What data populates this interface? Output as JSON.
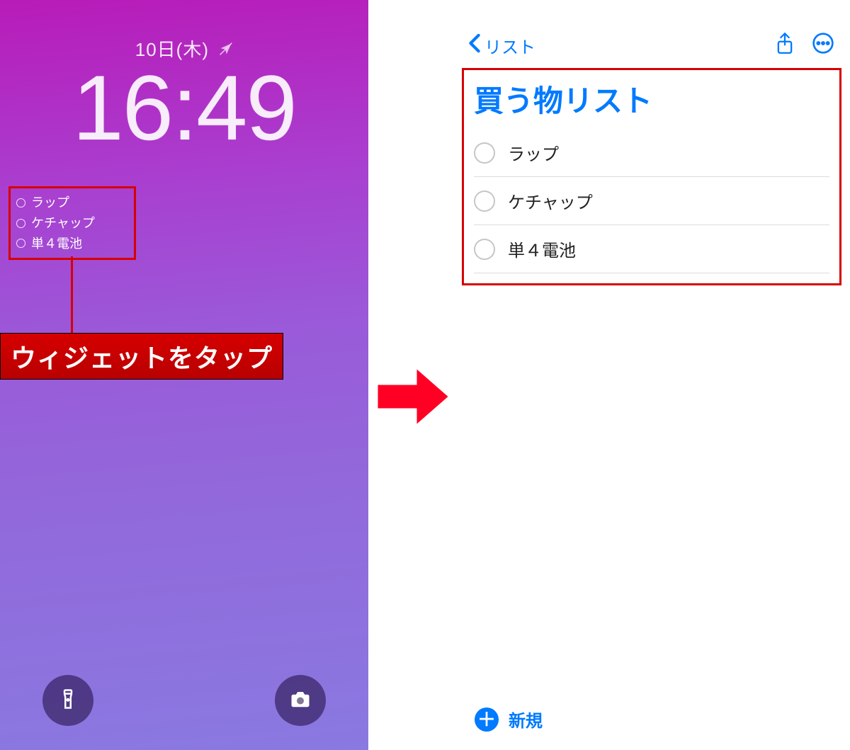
{
  "lockscreen": {
    "date": "10日(木)",
    "time": "16:49",
    "widget": {
      "items": [
        "ラップ",
        "ケチャップ",
        "単４電池"
      ]
    },
    "annotation": "ウィジェットをタップ"
  },
  "reminders": {
    "back_label": "リスト",
    "list_title": "買う物リスト",
    "items": [
      {
        "label": "ラップ"
      },
      {
        "label": "ケチャップ"
      },
      {
        "label": "単４電池"
      }
    ],
    "new_label": "新規"
  }
}
